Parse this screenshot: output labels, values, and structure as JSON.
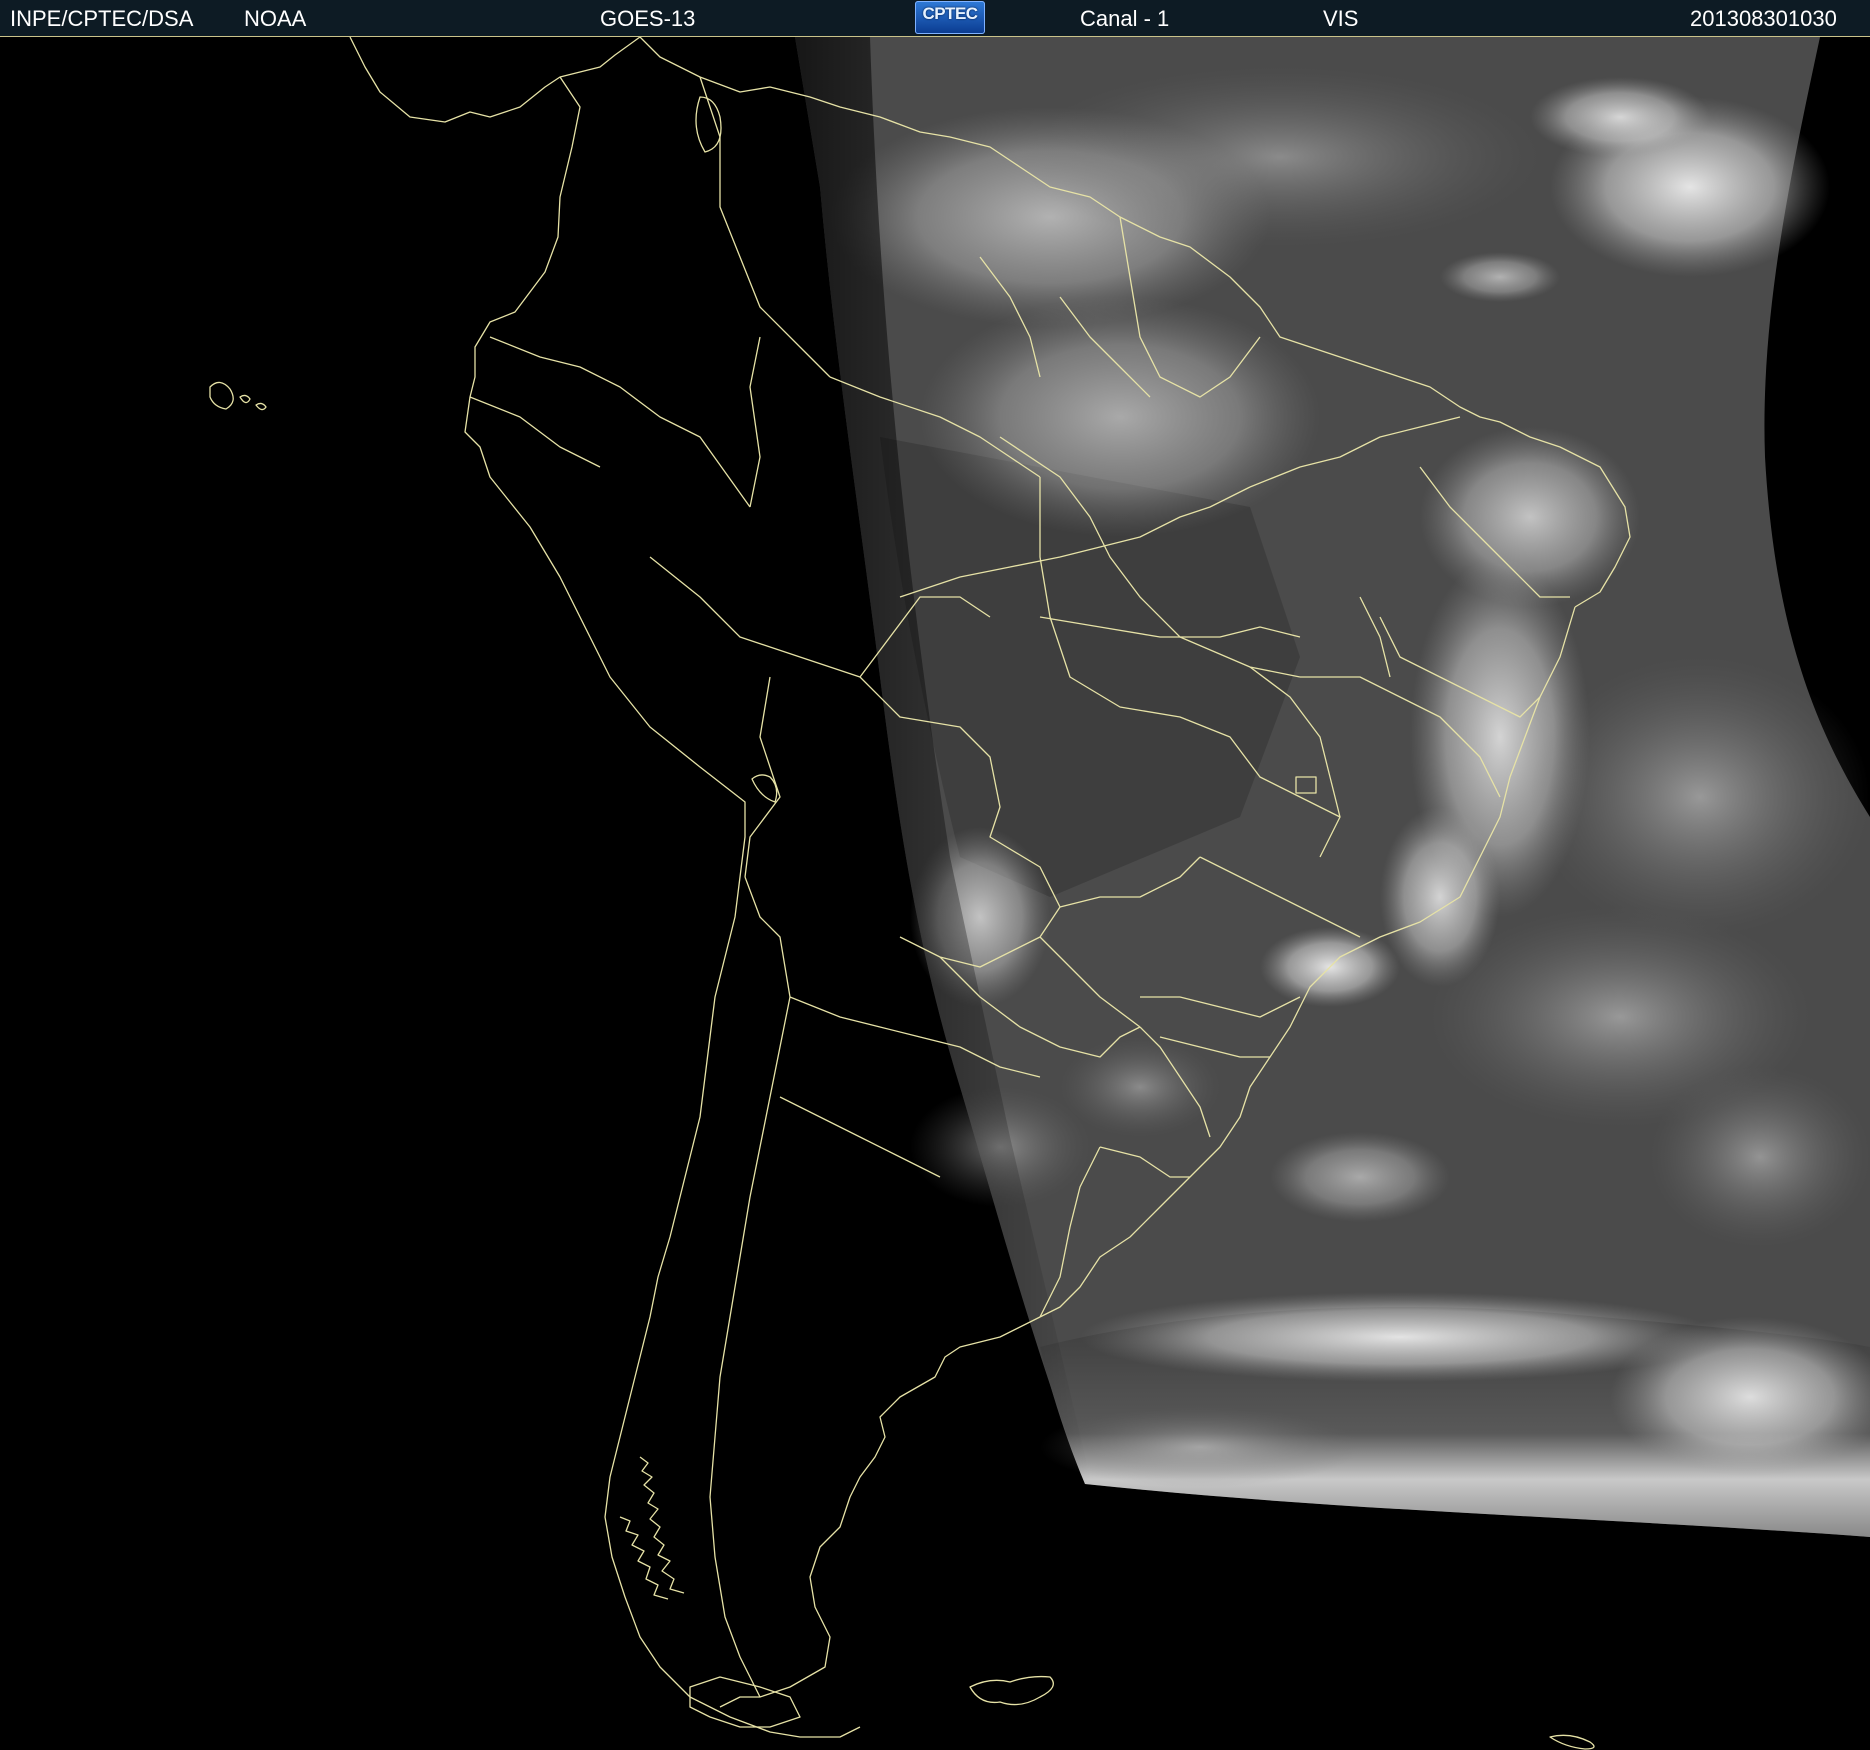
{
  "header": {
    "source": "INPE/CPTEC/DSA",
    "agency": "NOAA",
    "satellite": "GOES-13",
    "logo_text": "CPTEC",
    "channel": "Canal - 1",
    "band": "VIS",
    "timestamp": "201308301030"
  },
  "colors": {
    "header_bg": "#0d1b24",
    "border_lines": "#e6e2a6",
    "space_bg": "#000000",
    "cloud_white": "#f2f2f2",
    "surface_grey": "#4a4a4a"
  }
}
